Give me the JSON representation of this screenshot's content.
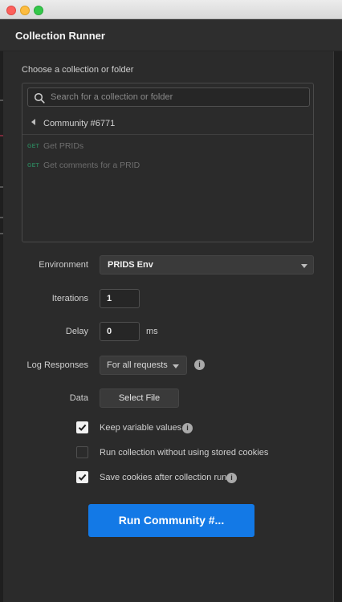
{
  "window": {
    "title": "Collection Runner"
  },
  "picker": {
    "label": "Choose a collection or folder",
    "search_placeholder": "Search for a collection or folder",
    "breadcrumb": "Community #6771",
    "requests": [
      {
        "method": "GET",
        "name": "Get PRIDs"
      },
      {
        "method": "GET",
        "name": "Get comments for a PRID"
      }
    ]
  },
  "form": {
    "environment": {
      "label": "Environment",
      "value": "PRIDS Env"
    },
    "iterations": {
      "label": "Iterations",
      "value": "1"
    },
    "delay": {
      "label": "Delay",
      "value": "0",
      "unit": "ms"
    },
    "log_responses": {
      "label": "Log Responses",
      "value": "For all requests"
    },
    "data": {
      "label": "Data",
      "button": "Select File"
    },
    "options": [
      {
        "label": "Keep variable values",
        "checked": true,
        "has_info": true
      },
      {
        "label": "Run collection without using stored cookies",
        "checked": false,
        "has_info": false
      },
      {
        "label": "Save cookies after collection run",
        "checked": true,
        "has_info": true
      }
    ]
  },
  "run_button": {
    "label": "Run Community #..."
  },
  "icons": {
    "info_glyph": "i"
  },
  "colors": {
    "accent": "#1379e6",
    "get_method": "#2c7a57"
  }
}
